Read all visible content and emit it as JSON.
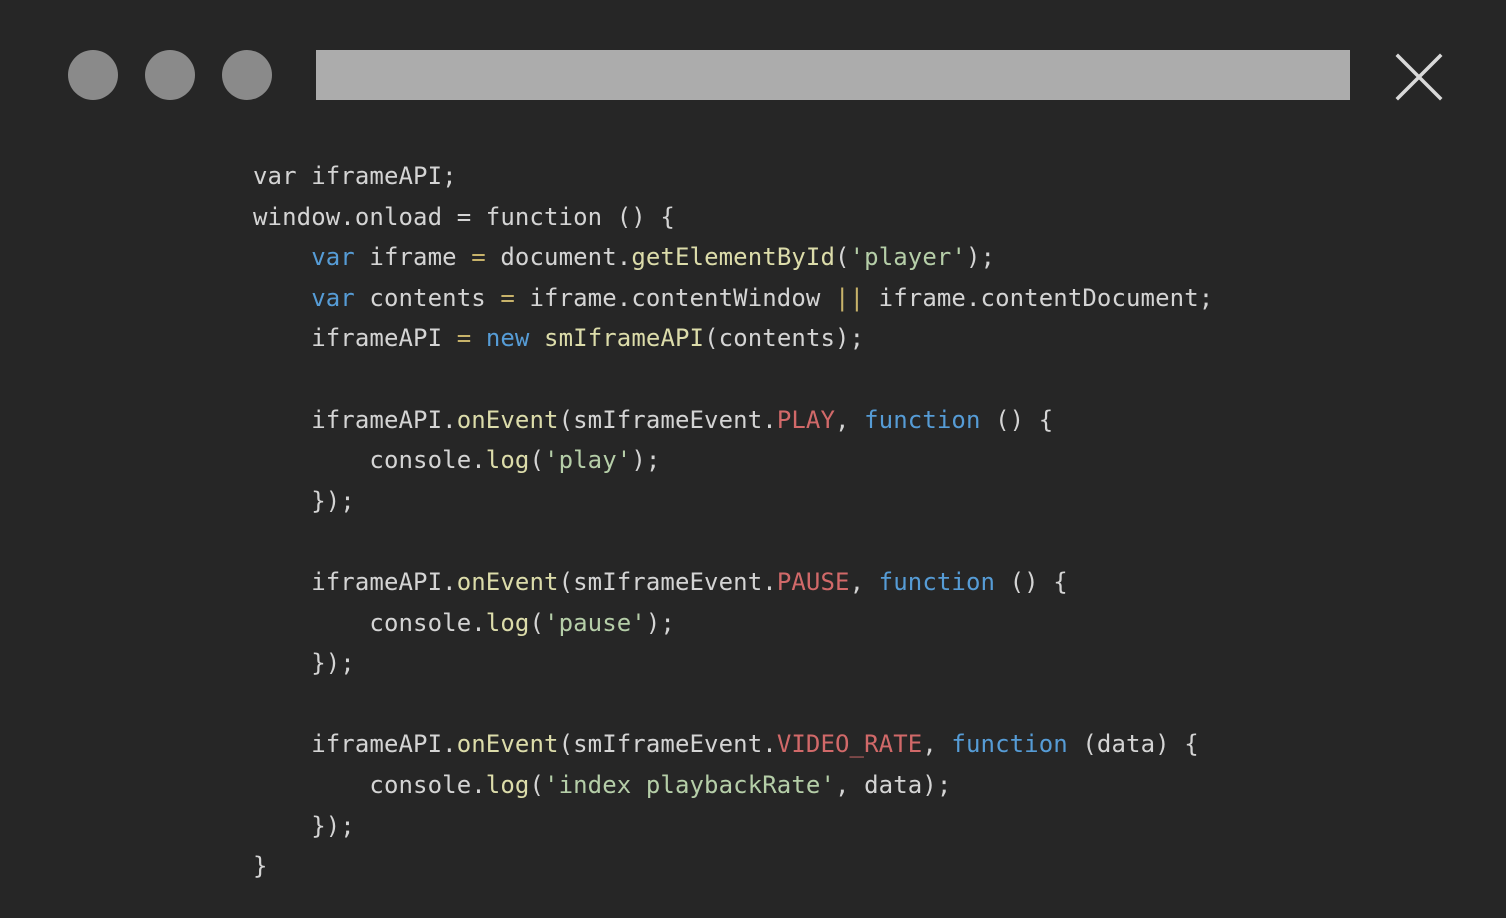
{
  "window": {
    "colors": {
      "background": "#262626",
      "dot": "#8a8a8a",
      "url_bar": "#acacac",
      "close_icon": "#d9d9d9"
    },
    "traffic_lights": [
      "window-dot-1",
      "window-dot-2",
      "window-dot-3"
    ],
    "close_icon": "close-icon"
  },
  "code": {
    "colors": {
      "plain": "#d4d4d4",
      "keyword": "#569cd6",
      "function": "#dcdcaa",
      "string": "#b5cea8",
      "constant": "#d16969",
      "operator": "#c8b36a"
    },
    "lines": [
      [
        {
          "t": "var iframeAPI;",
          "c": "plain"
        }
      ],
      [
        {
          "t": "window.onload = function () {",
          "c": "plain"
        }
      ],
      [
        {
          "t": "    ",
          "c": "plain"
        },
        {
          "t": "var",
          "c": "keyword"
        },
        {
          "t": " iframe ",
          "c": "plain"
        },
        {
          "t": "=",
          "c": "operator"
        },
        {
          "t": " document.",
          "c": "plain"
        },
        {
          "t": "getElementById",
          "c": "function"
        },
        {
          "t": "(",
          "c": "plain"
        },
        {
          "t": "'player'",
          "c": "string"
        },
        {
          "t": ");",
          "c": "plain"
        }
      ],
      [
        {
          "t": "    ",
          "c": "plain"
        },
        {
          "t": "var",
          "c": "keyword"
        },
        {
          "t": " contents ",
          "c": "plain"
        },
        {
          "t": "=",
          "c": "operator"
        },
        {
          "t": " iframe.contentWindow ",
          "c": "plain"
        },
        {
          "t": "||",
          "c": "operator"
        },
        {
          "t": " iframe.contentDocument;",
          "c": "plain"
        }
      ],
      [
        {
          "t": "    iframeAPI ",
          "c": "plain"
        },
        {
          "t": "=",
          "c": "operator"
        },
        {
          "t": " ",
          "c": "plain"
        },
        {
          "t": "new",
          "c": "keyword"
        },
        {
          "t": " ",
          "c": "plain"
        },
        {
          "t": "smIframeAPI",
          "c": "function"
        },
        {
          "t": "(contents);",
          "c": "plain"
        }
      ],
      [],
      [
        {
          "t": "    iframeAPI.",
          "c": "plain"
        },
        {
          "t": "onEvent",
          "c": "function"
        },
        {
          "t": "(smIframeEvent.",
          "c": "plain"
        },
        {
          "t": "PLAY",
          "c": "constant"
        },
        {
          "t": ", ",
          "c": "plain"
        },
        {
          "t": "function",
          "c": "keyword"
        },
        {
          "t": " () {",
          "c": "plain"
        }
      ],
      [
        {
          "t": "        console.",
          "c": "plain"
        },
        {
          "t": "log",
          "c": "function"
        },
        {
          "t": "(",
          "c": "plain"
        },
        {
          "t": "'play'",
          "c": "string"
        },
        {
          "t": ");",
          "c": "plain"
        }
      ],
      [
        {
          "t": "    });",
          "c": "plain"
        }
      ],
      [],
      [
        {
          "t": "    iframeAPI.",
          "c": "plain"
        },
        {
          "t": "onEvent",
          "c": "function"
        },
        {
          "t": "(smIframeEvent.",
          "c": "plain"
        },
        {
          "t": "PAUSE",
          "c": "constant"
        },
        {
          "t": ", ",
          "c": "plain"
        },
        {
          "t": "function",
          "c": "keyword"
        },
        {
          "t": " () {",
          "c": "plain"
        }
      ],
      [
        {
          "t": "        console.",
          "c": "plain"
        },
        {
          "t": "log",
          "c": "function"
        },
        {
          "t": "(",
          "c": "plain"
        },
        {
          "t": "'pause'",
          "c": "string"
        },
        {
          "t": ");",
          "c": "plain"
        }
      ],
      [
        {
          "t": "    });",
          "c": "plain"
        }
      ],
      [],
      [
        {
          "t": "    iframeAPI.",
          "c": "plain"
        },
        {
          "t": "onEvent",
          "c": "function"
        },
        {
          "t": "(smIframeEvent.",
          "c": "plain"
        },
        {
          "t": "VIDEO_RATE",
          "c": "constant"
        },
        {
          "t": ", ",
          "c": "plain"
        },
        {
          "t": "function",
          "c": "keyword"
        },
        {
          "t": " (data) {",
          "c": "plain"
        }
      ],
      [
        {
          "t": "        console.",
          "c": "plain"
        },
        {
          "t": "log",
          "c": "function"
        },
        {
          "t": "(",
          "c": "plain"
        },
        {
          "t": "'index playbackRate'",
          "c": "string"
        },
        {
          "t": ", data);",
          "c": "plain"
        }
      ],
      [
        {
          "t": "    });",
          "c": "plain"
        }
      ],
      [
        {
          "t": "}",
          "c": "plain"
        }
      ]
    ]
  }
}
